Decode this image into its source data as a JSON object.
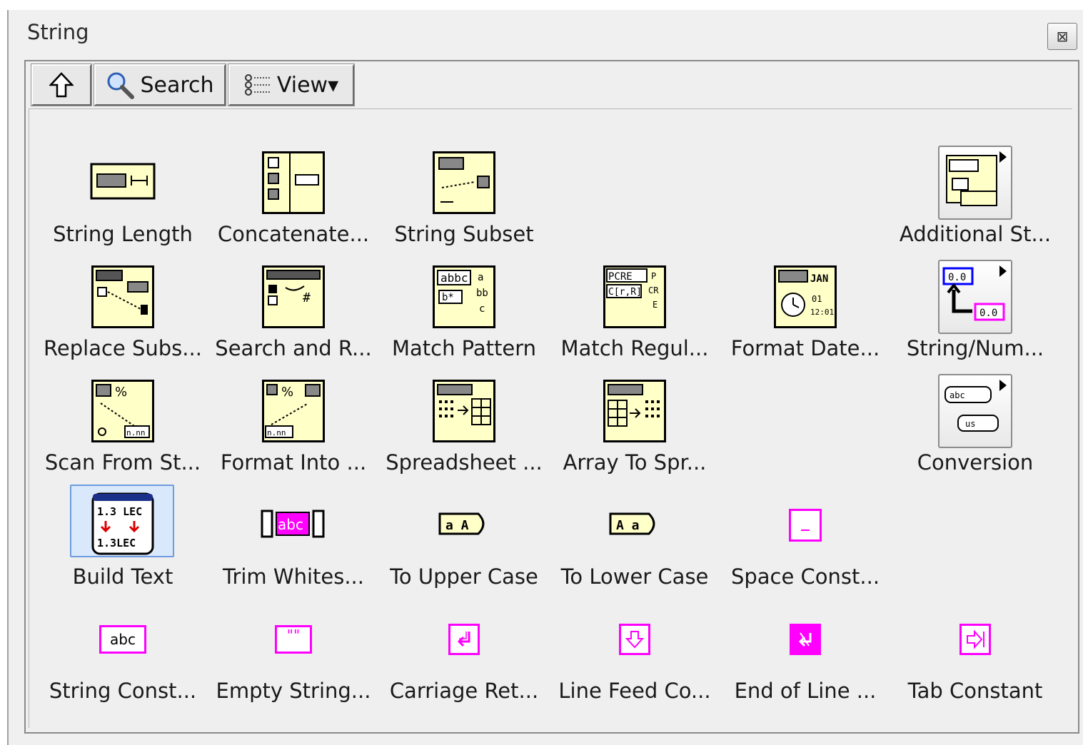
{
  "window": {
    "title": "String",
    "close_label": "⊠"
  },
  "toolbar": {
    "up_label": "⇧",
    "search_label": "Search",
    "view_label": "View▾"
  },
  "items": [
    {
      "label": "String Length"
    },
    {
      "label": "Concatenate..."
    },
    {
      "label": "String Subset"
    },
    {
      "label": "Additional St..."
    },
    {
      "label": "Replace Subs..."
    },
    {
      "label": "Search and R..."
    },
    {
      "label": "Match Pattern"
    },
    {
      "label": "Match Regul..."
    },
    {
      "label": "Format Date..."
    },
    {
      "label": "String/Num..."
    },
    {
      "label": "Scan From St..."
    },
    {
      "label": "Format Into ..."
    },
    {
      "label": "Spreadsheet ..."
    },
    {
      "label": "Array To Spr..."
    },
    {
      "label": "Conversion"
    },
    {
      "label": "Build Text"
    },
    {
      "label": "Trim Whites..."
    },
    {
      "label": "To Upper Case"
    },
    {
      "label": "To Lower Case"
    },
    {
      "label": "Space Const..."
    },
    {
      "label": "String Const..."
    },
    {
      "label": "Empty String..."
    },
    {
      "label": "Carriage Ret..."
    },
    {
      "label": "Line Feed Co..."
    },
    {
      "label": "End of Line ..."
    },
    {
      "label": "Tab Constant"
    }
  ],
  "icon_text": {
    "build_text_top": "1.3 LEC",
    "build_text_bottom": "1.3LEC",
    "trim": "abc",
    "string_const": "abc",
    "string_num_a": "0.0",
    "string_num_b": "0.0",
    "upper": "a A",
    "lower": "A a",
    "empty": "\"\"",
    "pcre": "PCRE",
    "jan": "JAN"
  },
  "colors": {
    "vi_fill": "#ffffc8",
    "constant_pink": "#ff00ff",
    "selection": "#d9e8fb"
  }
}
